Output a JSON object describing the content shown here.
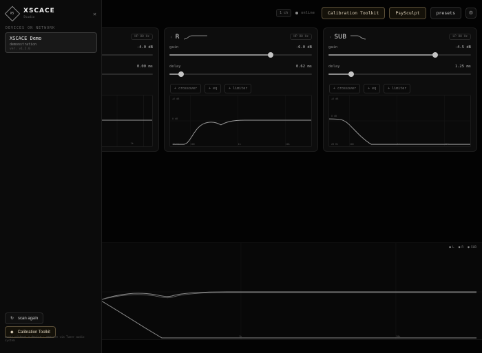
{
  "topbar": {
    "count_badge": "1 ch",
    "status": "online",
    "calibration_label": "Calibration Toolkit",
    "psysculpt_label": "PsySculpt",
    "presets_label": "presets",
    "settings_icon": "gear-icon"
  },
  "cards": [
    {
      "name": "",
      "badge": "HP 80 Hz",
      "gain_label": "",
      "gain_value": "-4.0 dB",
      "gain_fraction": 0.06,
      "delay_label": "",
      "delay_value": "0.00 ms",
      "delay_fraction": 0.06,
      "chips": [],
      "graph_labels": {
        "freq": [
          "2k"
        ]
      }
    },
    {
      "name": "R",
      "badge": "HP 80 Hz",
      "gain_label": "gain",
      "gain_value": "-6.0 dB",
      "gain_fraction": 0.71,
      "delay_label": "delay",
      "delay_value": "0.62 ms",
      "delay_fraction": 0.08,
      "chips": [
        "+ crossover",
        "+ eq",
        "+ limiter"
      ],
      "graph_labels": {
        "db": [
          "+6 dB",
          "0 dB"
        ],
        "freq": [
          "20 Hz",
          "100",
          "1k",
          "10k"
        ]
      }
    },
    {
      "name": "SUB",
      "badge": "LP 80 Hz",
      "gain_label": "gain",
      "gain_value": "-4.5 dB",
      "gain_fraction": 0.75,
      "delay_label": "delay",
      "delay_value": "1.25 ms",
      "delay_fraction": 0.16,
      "chips": [
        "+ crossover",
        "+ eq",
        "+ limiter"
      ],
      "graph_labels": {
        "db": [
          "+6 dB",
          "0 dB"
        ],
        "freq": [
          "20 Hz",
          "100",
          "1k",
          "10k"
        ]
      }
    }
  ],
  "bottom": {
    "legend": [
      "L",
      "R",
      "SUB"
    ],
    "freq_labels": [
      "1k",
      "10k"
    ]
  },
  "sidebar": {
    "brand": "XSCACE",
    "brand_sub": "Studio",
    "logo_text": "XS",
    "section_label": "DEVICES ON NETWORK",
    "device": {
      "name": "XSCACE Demo",
      "type": "demonstration",
      "version": "ver. v1.2.0"
    },
    "scan_label": "scan again",
    "calibration_label": "Calibration Toolkit",
    "note": "works without a device · measure via Tuner audio system"
  },
  "colors": {
    "accent_border": "#5b4f38",
    "accent_text": "#e2d6bf",
    "curve": "#9a9a9a"
  }
}
